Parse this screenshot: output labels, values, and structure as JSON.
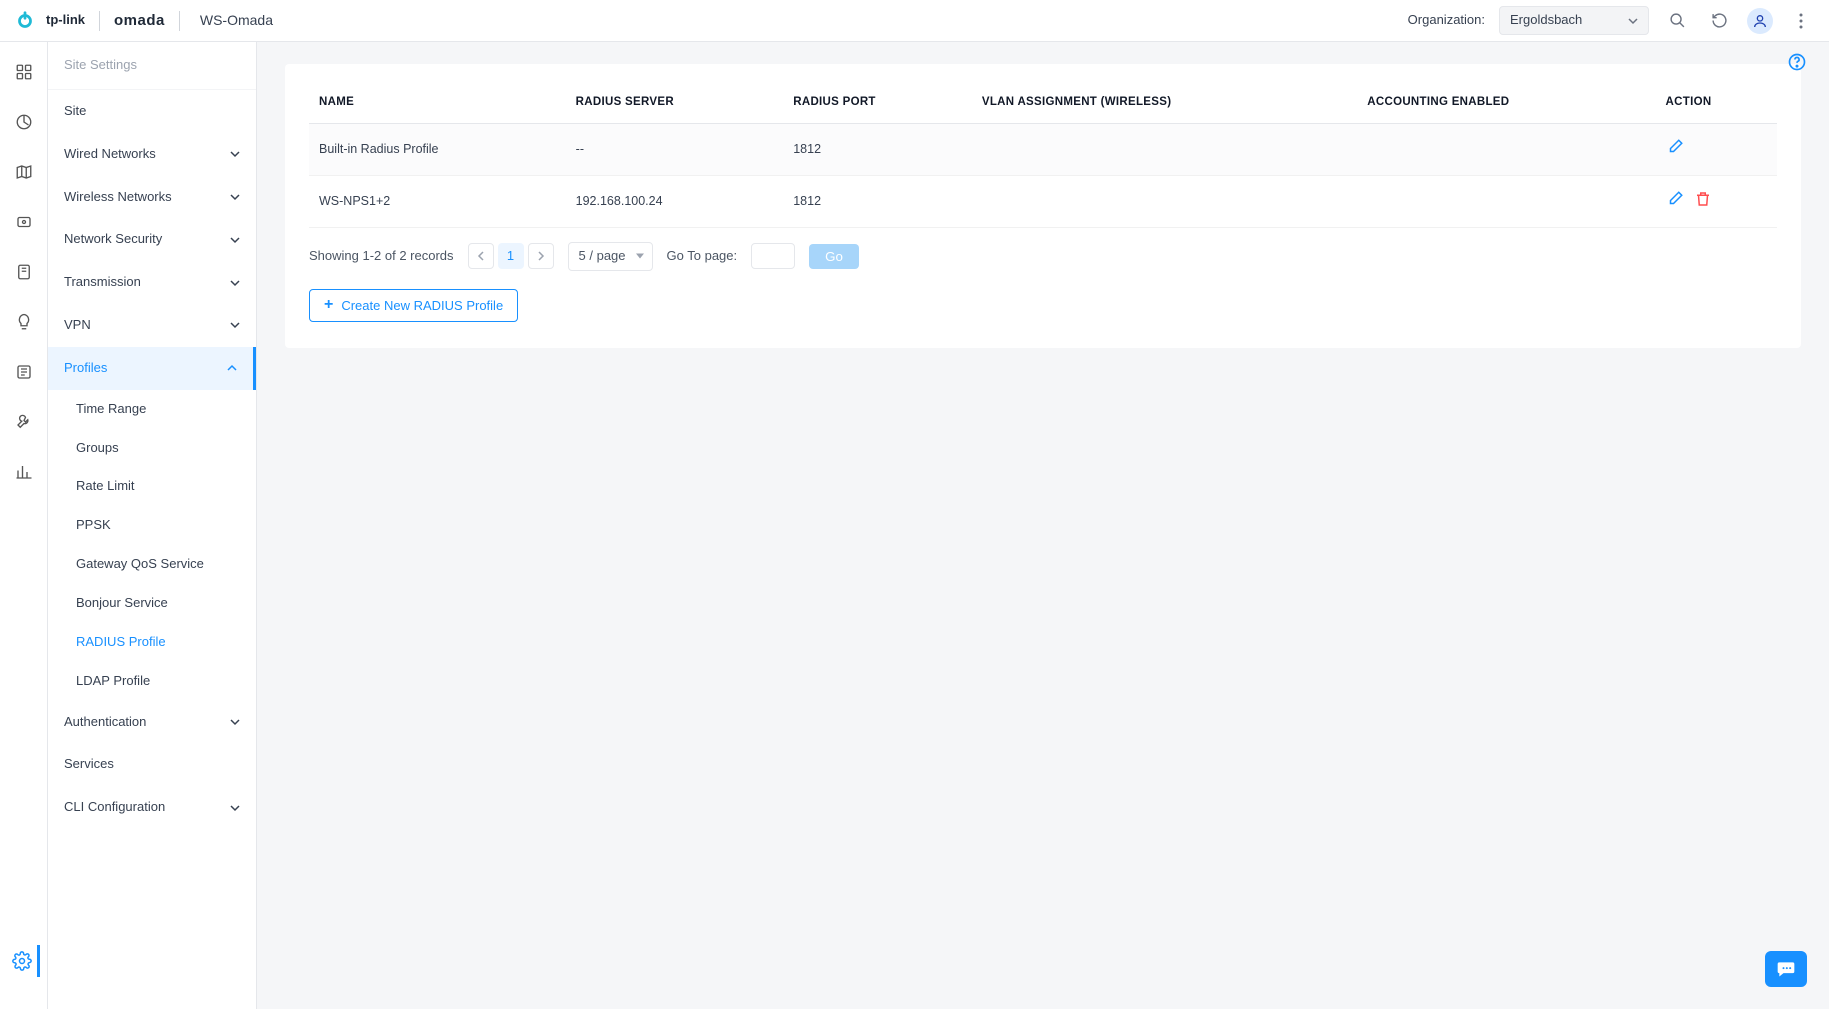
{
  "header": {
    "brand1": "tp-link",
    "brand2": "omada",
    "site_name": "WS-Omada",
    "org_label": "Organization:",
    "org_value": "Ergoldsbach"
  },
  "rail": {
    "items": [
      "dashboard",
      "stats",
      "map",
      "devices",
      "clients",
      "insights",
      "log",
      "tools",
      "reports"
    ],
    "bottom": "settings"
  },
  "sidebar": {
    "title": "Site Settings",
    "items": [
      {
        "label": "Site",
        "expandable": false
      },
      {
        "label": "Wired Networks",
        "expandable": true
      },
      {
        "label": "Wireless Networks",
        "expandable": true
      },
      {
        "label": "Network Security",
        "expandable": true
      },
      {
        "label": "Transmission",
        "expandable": true
      },
      {
        "label": "VPN",
        "expandable": true
      },
      {
        "label": "Profiles",
        "expandable": true,
        "expanded": true,
        "children": [
          {
            "label": "Time Range"
          },
          {
            "label": "Groups"
          },
          {
            "label": "Rate Limit"
          },
          {
            "label": "PPSK"
          },
          {
            "label": "Gateway QoS Service"
          },
          {
            "label": "Bonjour Service"
          },
          {
            "label": "RADIUS Profile",
            "active": true
          },
          {
            "label": "LDAP Profile"
          }
        ]
      },
      {
        "label": "Authentication",
        "expandable": true
      },
      {
        "label": "Services",
        "expandable": false
      },
      {
        "label": "CLI Configuration",
        "expandable": true
      }
    ]
  },
  "table": {
    "columns": [
      "NAME",
      "RADIUS SERVER",
      "RADIUS PORT",
      "VLAN ASSIGNMENT (WIRELESS)",
      "ACCOUNTING ENABLED",
      "ACTION"
    ],
    "rows": [
      {
        "name": "Built-in Radius Profile",
        "server": "--",
        "port": "1812",
        "vlan": "",
        "acct": "",
        "can_delete": false
      },
      {
        "name": "WS-NPS1+2",
        "server": "192.168.100.24",
        "port": "1812",
        "vlan": "",
        "acct": "",
        "can_delete": true
      }
    ]
  },
  "pagination": {
    "summary": "Showing 1-2 of 2 records",
    "page": "1",
    "per_page": "5 / page",
    "goto_label": "Go To page:",
    "go_label": "Go"
  },
  "actions": {
    "create_label": "Create New RADIUS Profile"
  }
}
